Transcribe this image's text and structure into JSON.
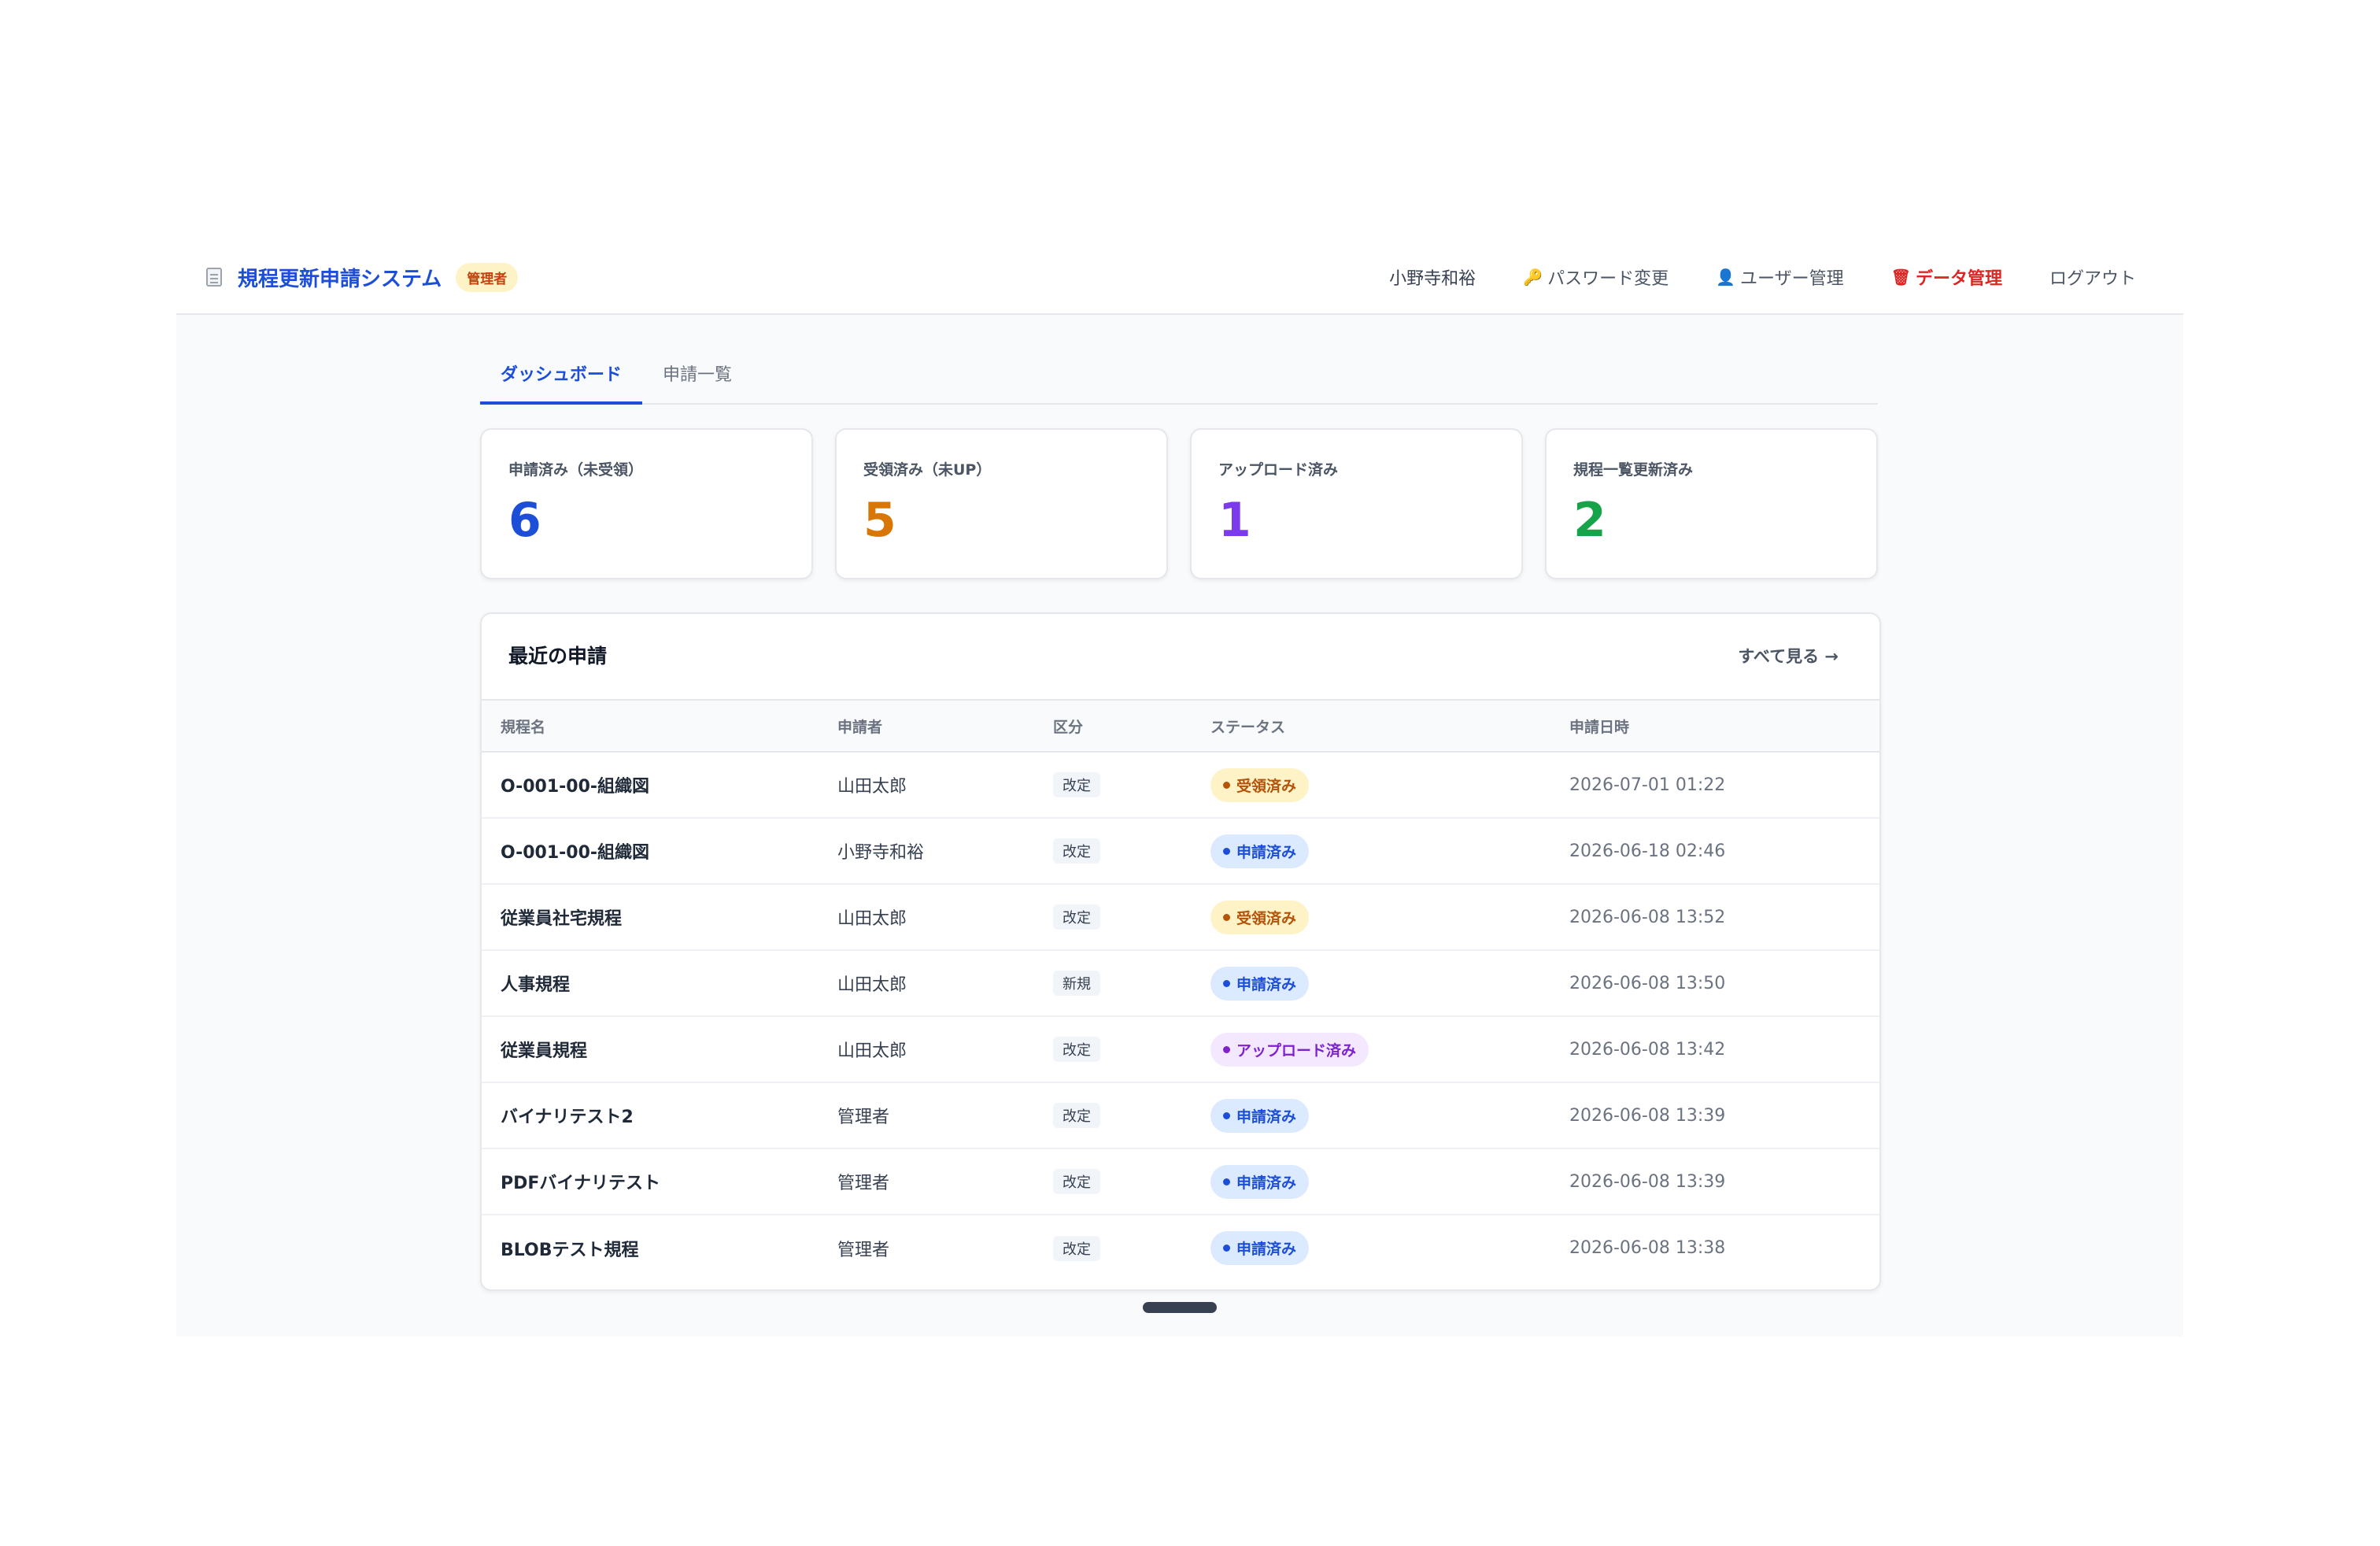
{
  "header": {
    "app_title": "規程更新申請システム",
    "role_badge": "管理者",
    "user_name": "小野寺和裕",
    "nav": {
      "password_change": "パスワード変更",
      "user_management": "ユーザー管理",
      "data_management": "データ管理",
      "logout": "ログアウト"
    }
  },
  "tabs": [
    "ダッシュボード",
    "申請一覧"
  ],
  "summary_cards": [
    {
      "label": "申請済み（未受領）",
      "value": "6",
      "color": "#1d4ed8"
    },
    {
      "label": "受領済み（未UP）",
      "value": "5",
      "color": "#d97706"
    },
    {
      "label": "アップロード済み",
      "value": "1",
      "color": "#7c3aed"
    },
    {
      "label": "規程一覧更新済み",
      "value": "2",
      "color": "#16a34a"
    }
  ],
  "recent": {
    "title": "最近の申請",
    "see_all": "すべて見る →",
    "columns": [
      "規程名",
      "申請者",
      "区分",
      "ステータス",
      "申請日時"
    ],
    "rows": [
      {
        "name": "O-001-00-組織図",
        "applicant": "山田太郎",
        "kubun": "改定",
        "status": "受領済み",
        "status_kind": "accepted",
        "date": "2026-07-01 01:22"
      },
      {
        "name": "O-001-00-組織図",
        "applicant": "小野寺和裕",
        "kubun": "改定",
        "status": "申請済み",
        "status_kind": "applied",
        "date": "2026-06-18 02:46"
      },
      {
        "name": "従業員社宅規程",
        "applicant": "山田太郎",
        "kubun": "改定",
        "status": "受領済み",
        "status_kind": "accepted",
        "date": "2026-06-08 13:52"
      },
      {
        "name": "人事規程",
        "applicant": "山田太郎",
        "kubun": "新規",
        "status": "申請済み",
        "status_kind": "applied",
        "date": "2026-06-08 13:50"
      },
      {
        "name": "従業員規程",
        "applicant": "山田太郎",
        "kubun": "改定",
        "status": "アップロード済み",
        "status_kind": "uploaded",
        "date": "2026-06-08 13:42"
      },
      {
        "name": "バイナリテスト2",
        "applicant": "管理者",
        "kubun": "改定",
        "status": "申請済み",
        "status_kind": "applied",
        "date": "2026-06-08 13:39"
      },
      {
        "name": "PDFバイナリテスト",
        "applicant": "管理者",
        "kubun": "改定",
        "status": "申請済み",
        "status_kind": "applied",
        "date": "2026-06-08 13:39"
      },
      {
        "name": "BLOBテスト規程",
        "applicant": "管理者",
        "kubun": "改定",
        "status": "申請済み",
        "status_kind": "applied",
        "date": "2026-06-08 13:38"
      }
    ]
  }
}
